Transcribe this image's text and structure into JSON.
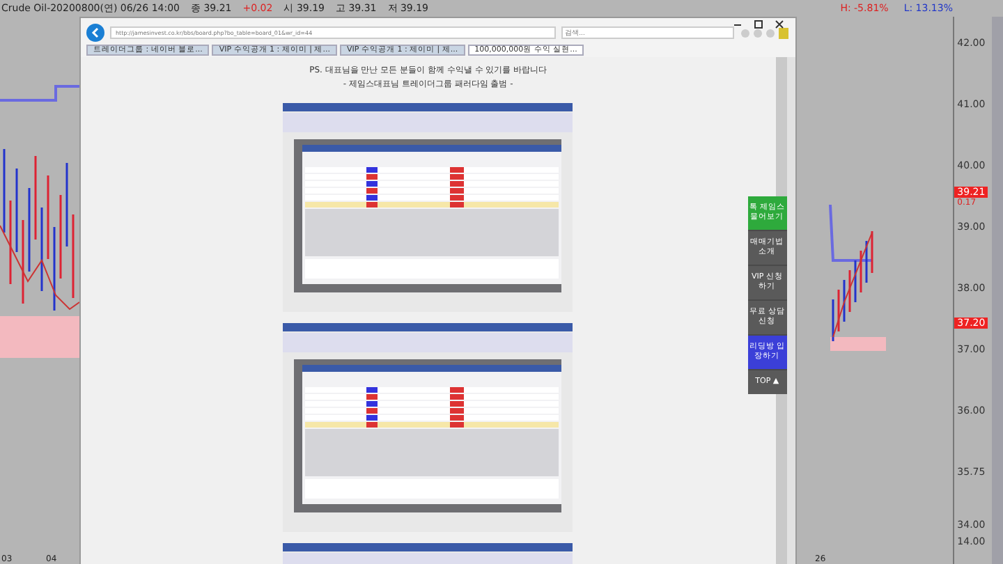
{
  "quote_bar": {
    "symbol": "Crude Oil-20200800(연) 06/26 14:00",
    "close": "종 39.21",
    "change": "+0.02",
    "open": "시 39.19",
    "high": "고 39.31",
    "low": "저 39.19"
  },
  "range_stats": {
    "high": "H: -5.81%",
    "low": "L: 13.13%"
  },
  "price_axis": {
    "ticks": [
      "42.00",
      "41.00",
      "40.00",
      "39.00",
      "38.00",
      "37.00",
      "36.00",
      "35.75",
      "34.00",
      "14.00"
    ],
    "tags": [
      {
        "text": "39.21",
        "sub": "0.17"
      },
      {
        "text": "37.20"
      }
    ]
  },
  "time_axis": [
    "03",
    "04",
    "26"
  ],
  "browser": {
    "url": "http://jamesinvest.co.kr/bbs/board.php?bo_table=board_01&wr_id=44",
    "search": {
      "placeholder": "검색..."
    },
    "tabs": [
      {
        "label": "트레이더그룹 : 네이버 블로...",
        "selected": false
      },
      {
        "label": "VIP 수익공개 1 : 제이미 | 제...",
        "selected": false
      },
      {
        "label": "VIP 수익공개 1 : 제이미 | 제...",
        "selected": false
      },
      {
        "label": "100,000,000원 수익 실현...",
        "selected": true
      }
    ],
    "post_lines": [
      "PS. 대표님을 만난 모든 분들이 함께 수익낼 수 있기를 바랍니다",
      "- 제임스대표님 트레이더그룹 패러다임 출범 -"
    ],
    "screenshots": [
      {
        "kind": "trade-window"
      },
      {
        "kind": "trade-window"
      },
      {
        "kind": "trade-window"
      }
    ]
  },
  "side_menu": [
    {
      "label": "톡 제임스 물어보기",
      "color": "#2eaa3c"
    },
    {
      "label": "매매기법 소개",
      "color": "#5a5a5a"
    },
    {
      "label": "VIP 신청하기",
      "color": "#5a5a5a"
    },
    {
      "label": "무료 상담신청",
      "color": "#5a5a5a"
    },
    {
      "label": "리딩방 입장하기",
      "color": "#3b3fd8"
    },
    {
      "label": "TOP ▲",
      "color": "#5a5a5a"
    }
  ]
}
